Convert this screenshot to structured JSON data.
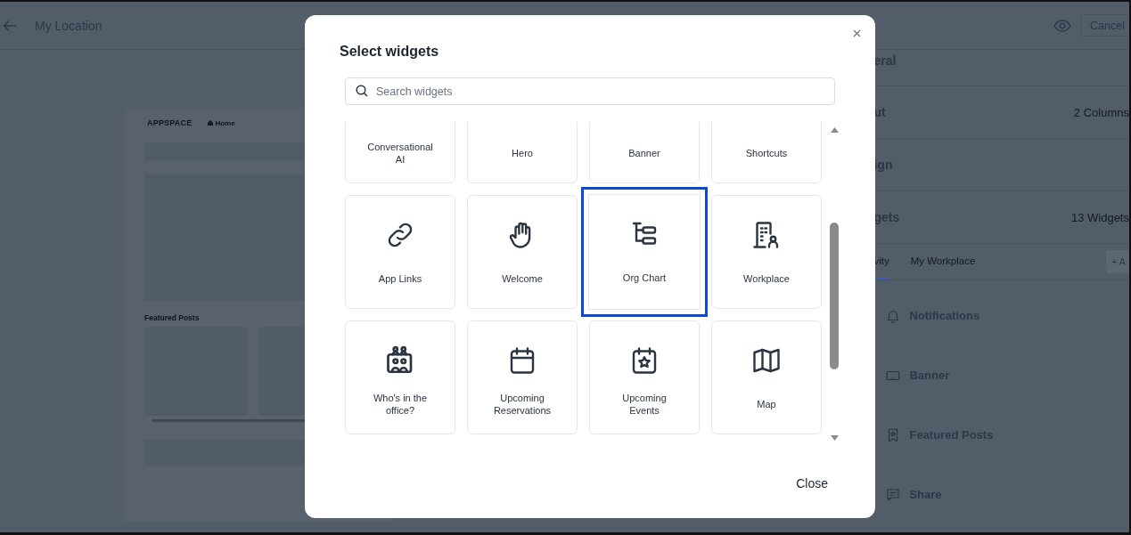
{
  "header": {
    "title": "My Location",
    "cancel_button": "Cancel"
  },
  "preview": {
    "logo": "APPSPACE",
    "nav_item": "Home",
    "section_title": "Featured Posts"
  },
  "settings": {
    "rows": [
      {
        "label": "eral"
      },
      {
        "label": "ut",
        "value": "2 Columns"
      },
      {
        "label": "ign"
      },
      {
        "label": "gets",
        "value": "13 Widgets"
      }
    ],
    "tabs": [
      {
        "label": "vity",
        "selected": true
      },
      {
        "label": "My Workplace",
        "selected": false
      }
    ],
    "add_button": "+ A",
    "widgets": [
      {
        "label": "Notifications",
        "kind": "bell"
      },
      {
        "label": "Banner",
        "kind": "banner"
      },
      {
        "label": "Featured Posts",
        "kind": "bookmark"
      },
      {
        "label": "Share",
        "kind": "message"
      }
    ]
  },
  "dialog": {
    "title": "Select widgets",
    "search": {
      "placeholder": "Search widgets"
    },
    "widgets": [
      {
        "label": "Conversational AI",
        "selected": false
      },
      {
        "label": "Hero",
        "selected": false
      },
      {
        "label": "Banner",
        "selected": false
      },
      {
        "label": "Shortcuts",
        "selected": false
      },
      {
        "label": "App Links",
        "kind": "link",
        "selected": false
      },
      {
        "label": "Welcome",
        "kind": "hand",
        "selected": false
      },
      {
        "label": "Org Chart",
        "kind": "org-chart",
        "selected": true
      },
      {
        "label": "Workplace",
        "kind": "building",
        "selected": false
      },
      {
        "label": "Who's in the office?",
        "kind": "people",
        "selected": false
      },
      {
        "label": "Upcoming Reservations",
        "kind": "calendar",
        "selected": false
      },
      {
        "label": "Upcoming Events",
        "kind": "calendar-star",
        "selected": false
      },
      {
        "label": "Map",
        "kind": "map",
        "selected": false
      }
    ],
    "close_button": "Close"
  }
}
